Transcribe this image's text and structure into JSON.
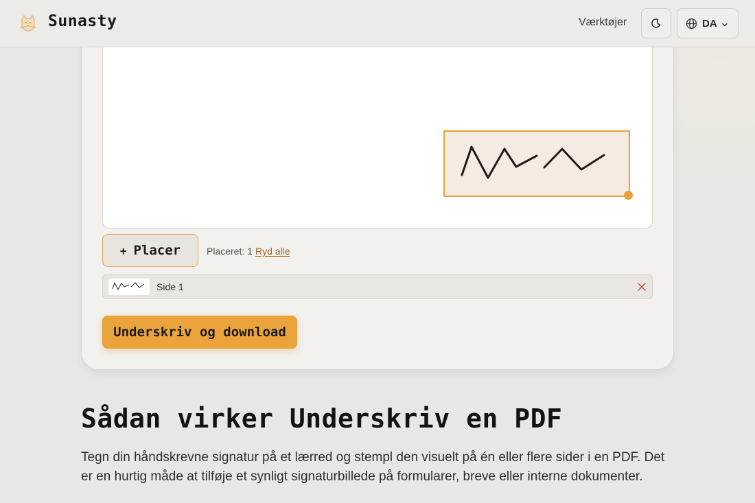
{
  "header": {
    "brand": "Sunasty",
    "nav_tools": "Værktøjer",
    "language_code": "DA"
  },
  "editor": {
    "place_button_icon": "+",
    "place_button_label": "Placer",
    "placed_count": "Placeret: 1",
    "clear_all": "Ryd alle",
    "placements": [
      {
        "label": "Side 1"
      }
    ],
    "sign_button": "Underskriv og download"
  },
  "section": {
    "title": "Sådan virker Underskriv en PDF",
    "paragraph": "Tegn din håndskrevne signatur på et lærred og stempl den visuelt på én eller flere sider i en PDF. Det er en hurtig måde at tilføje et synligt signaturbillede på formularer, breve eller interne dokumenter."
  },
  "colors": {
    "accent": "#eba43c",
    "link": "#a8631a",
    "background": "#e9e7e3"
  },
  "icons": [
    "logo-icon",
    "moon-icon",
    "globe-icon",
    "chevron-down-icon",
    "close-icon"
  ]
}
